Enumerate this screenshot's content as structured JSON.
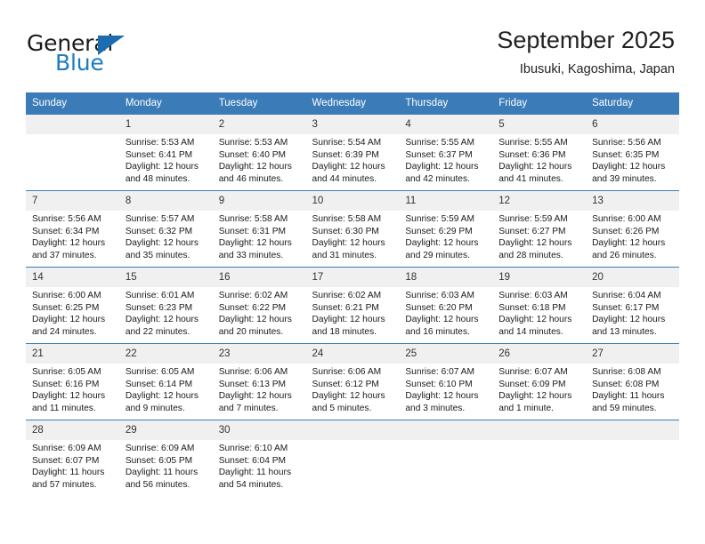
{
  "brand": {
    "name_top": "General",
    "name_bottom": "Blue",
    "triangle_color": "#1b6cb0",
    "blue_text_color": "#1b7cc1"
  },
  "header": {
    "title": "September 2025",
    "subtitle": "Ibusuki, Kagoshima, Japan"
  },
  "theme": {
    "header_bg": "#3b7cb8",
    "header_text": "#ffffff",
    "daynum_bg": "#f0f0f0",
    "grid_line": "#3b7cb8"
  },
  "calendar": {
    "weekday_headers": [
      "Sunday",
      "Monday",
      "Tuesday",
      "Wednesday",
      "Thursday",
      "Friday",
      "Saturday"
    ],
    "weeks": [
      [
        {
          "day": "",
          "lines": []
        },
        {
          "day": "1",
          "lines": [
            "Sunrise: 5:53 AM",
            "Sunset: 6:41 PM",
            "Daylight: 12 hours",
            "and 48 minutes."
          ]
        },
        {
          "day": "2",
          "lines": [
            "Sunrise: 5:53 AM",
            "Sunset: 6:40 PM",
            "Daylight: 12 hours",
            "and 46 minutes."
          ]
        },
        {
          "day": "3",
          "lines": [
            "Sunrise: 5:54 AM",
            "Sunset: 6:39 PM",
            "Daylight: 12 hours",
            "and 44 minutes."
          ]
        },
        {
          "day": "4",
          "lines": [
            "Sunrise: 5:55 AM",
            "Sunset: 6:37 PM",
            "Daylight: 12 hours",
            "and 42 minutes."
          ]
        },
        {
          "day": "5",
          "lines": [
            "Sunrise: 5:55 AM",
            "Sunset: 6:36 PM",
            "Daylight: 12 hours",
            "and 41 minutes."
          ]
        },
        {
          "day": "6",
          "lines": [
            "Sunrise: 5:56 AM",
            "Sunset: 6:35 PM",
            "Daylight: 12 hours",
            "and 39 minutes."
          ]
        }
      ],
      [
        {
          "day": "7",
          "lines": [
            "Sunrise: 5:56 AM",
            "Sunset: 6:34 PM",
            "Daylight: 12 hours",
            "and 37 minutes."
          ]
        },
        {
          "day": "8",
          "lines": [
            "Sunrise: 5:57 AM",
            "Sunset: 6:32 PM",
            "Daylight: 12 hours",
            "and 35 minutes."
          ]
        },
        {
          "day": "9",
          "lines": [
            "Sunrise: 5:58 AM",
            "Sunset: 6:31 PM",
            "Daylight: 12 hours",
            "and 33 minutes."
          ]
        },
        {
          "day": "10",
          "lines": [
            "Sunrise: 5:58 AM",
            "Sunset: 6:30 PM",
            "Daylight: 12 hours",
            "and 31 minutes."
          ]
        },
        {
          "day": "11",
          "lines": [
            "Sunrise: 5:59 AM",
            "Sunset: 6:29 PM",
            "Daylight: 12 hours",
            "and 29 minutes."
          ]
        },
        {
          "day": "12",
          "lines": [
            "Sunrise: 5:59 AM",
            "Sunset: 6:27 PM",
            "Daylight: 12 hours",
            "and 28 minutes."
          ]
        },
        {
          "day": "13",
          "lines": [
            "Sunrise: 6:00 AM",
            "Sunset: 6:26 PM",
            "Daylight: 12 hours",
            "and 26 minutes."
          ]
        }
      ],
      [
        {
          "day": "14",
          "lines": [
            "Sunrise: 6:00 AM",
            "Sunset: 6:25 PM",
            "Daylight: 12 hours",
            "and 24 minutes."
          ]
        },
        {
          "day": "15",
          "lines": [
            "Sunrise: 6:01 AM",
            "Sunset: 6:23 PM",
            "Daylight: 12 hours",
            "and 22 minutes."
          ]
        },
        {
          "day": "16",
          "lines": [
            "Sunrise: 6:02 AM",
            "Sunset: 6:22 PM",
            "Daylight: 12 hours",
            "and 20 minutes."
          ]
        },
        {
          "day": "17",
          "lines": [
            "Sunrise: 6:02 AM",
            "Sunset: 6:21 PM",
            "Daylight: 12 hours",
            "and 18 minutes."
          ]
        },
        {
          "day": "18",
          "lines": [
            "Sunrise: 6:03 AM",
            "Sunset: 6:20 PM",
            "Daylight: 12 hours",
            "and 16 minutes."
          ]
        },
        {
          "day": "19",
          "lines": [
            "Sunrise: 6:03 AM",
            "Sunset: 6:18 PM",
            "Daylight: 12 hours",
            "and 14 minutes."
          ]
        },
        {
          "day": "20",
          "lines": [
            "Sunrise: 6:04 AM",
            "Sunset: 6:17 PM",
            "Daylight: 12 hours",
            "and 13 minutes."
          ]
        }
      ],
      [
        {
          "day": "21",
          "lines": [
            "Sunrise: 6:05 AM",
            "Sunset: 6:16 PM",
            "Daylight: 12 hours",
            "and 11 minutes."
          ]
        },
        {
          "day": "22",
          "lines": [
            "Sunrise: 6:05 AM",
            "Sunset: 6:14 PM",
            "Daylight: 12 hours",
            "and 9 minutes."
          ]
        },
        {
          "day": "23",
          "lines": [
            "Sunrise: 6:06 AM",
            "Sunset: 6:13 PM",
            "Daylight: 12 hours",
            "and 7 minutes."
          ]
        },
        {
          "day": "24",
          "lines": [
            "Sunrise: 6:06 AM",
            "Sunset: 6:12 PM",
            "Daylight: 12 hours",
            "and 5 minutes."
          ]
        },
        {
          "day": "25",
          "lines": [
            "Sunrise: 6:07 AM",
            "Sunset: 6:10 PM",
            "Daylight: 12 hours",
            "and 3 minutes."
          ]
        },
        {
          "day": "26",
          "lines": [
            "Sunrise: 6:07 AM",
            "Sunset: 6:09 PM",
            "Daylight: 12 hours",
            "and 1 minute."
          ]
        },
        {
          "day": "27",
          "lines": [
            "Sunrise: 6:08 AM",
            "Sunset: 6:08 PM",
            "Daylight: 11 hours",
            "and 59 minutes."
          ]
        }
      ],
      [
        {
          "day": "28",
          "lines": [
            "Sunrise: 6:09 AM",
            "Sunset: 6:07 PM",
            "Daylight: 11 hours",
            "and 57 minutes."
          ]
        },
        {
          "day": "29",
          "lines": [
            "Sunrise: 6:09 AM",
            "Sunset: 6:05 PM",
            "Daylight: 11 hours",
            "and 56 minutes."
          ]
        },
        {
          "day": "30",
          "lines": [
            "Sunrise: 6:10 AM",
            "Sunset: 6:04 PM",
            "Daylight: 11 hours",
            "and 54 minutes."
          ]
        },
        {
          "day": "",
          "lines": []
        },
        {
          "day": "",
          "lines": []
        },
        {
          "day": "",
          "lines": []
        },
        {
          "day": "",
          "lines": []
        }
      ]
    ]
  }
}
